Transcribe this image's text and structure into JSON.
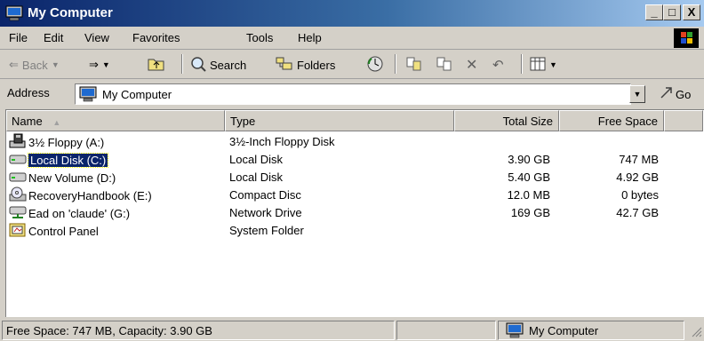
{
  "window": {
    "title": "My Computer",
    "buttons": {
      "minimize": "_",
      "maximize": "□",
      "close": "X"
    }
  },
  "menu": [
    "File",
    "Edit",
    "View",
    "Favorites",
    "Tools",
    "Help"
  ],
  "toolbar": {
    "back": "Back",
    "forward_arrow": "⇒",
    "search": "Search",
    "folders": "Folders"
  },
  "address": {
    "label": "Address",
    "value": "My Computer",
    "go": "Go"
  },
  "columns": {
    "name": "Name",
    "type": "Type",
    "total_size": "Total Size",
    "free_space": "Free Space"
  },
  "items": [
    {
      "name": "3½ Floppy (A:)",
      "type": "3½-Inch Floppy Disk",
      "total": "",
      "free": "",
      "icon": "floppy-drive-icon"
    },
    {
      "name": "Local Disk (C:)",
      "type": "Local Disk",
      "total": "3.90 GB",
      "free": "747 MB",
      "icon": "hard-drive-icon",
      "selected": true
    },
    {
      "name": "New Volume (D:)",
      "type": "Local Disk",
      "total": "5.40 GB",
      "free": "4.92 GB",
      "icon": "hard-drive-icon"
    },
    {
      "name": "RecoveryHandbook (E:)",
      "type": "Compact Disc",
      "total": "12.0 MB",
      "free": "0 bytes",
      "icon": "cd-drive-icon"
    },
    {
      "name": "Ead on 'claude' (G:)",
      "type": "Network Drive",
      "total": "169 GB",
      "free": "42.7 GB",
      "icon": "network-drive-icon"
    },
    {
      "name": "Control Panel",
      "type": "System Folder",
      "total": "",
      "free": "",
      "icon": "control-panel-icon"
    }
  ],
  "status": {
    "info": "Free Space: 747 MB, Capacity: 3.90 GB",
    "zone": "My Computer"
  },
  "colors": {
    "title_start": "#0a246a",
    "title_end": "#a6caf0",
    "selection": "#0a246a",
    "face": "#d4d0c8"
  }
}
